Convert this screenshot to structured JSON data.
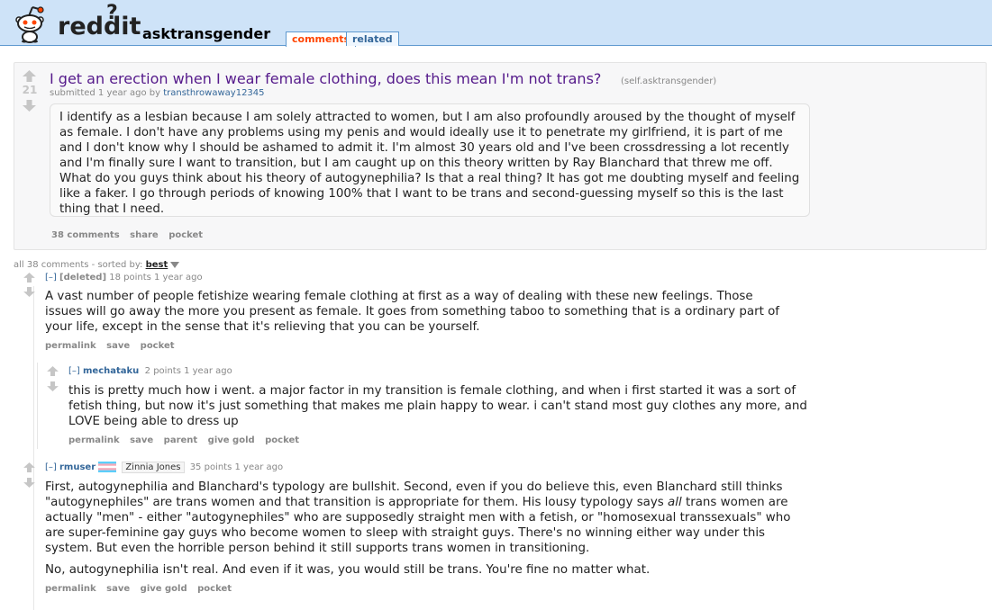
{
  "header": {
    "logo_text": "reddit",
    "logo_mark": "?",
    "subreddit": "asktransgender",
    "tabs": [
      {
        "label": "comments"
      },
      {
        "label": "related"
      }
    ]
  },
  "post": {
    "score": "21",
    "title": "I get an erection when I wear female clothing, does this mean I'm not trans?",
    "domain": "(self.asktransgender)",
    "tagline_prefix": "submitted 1 year ago by",
    "author": "transthrowaway12345",
    "selftext": "I identify as a lesbian because I am solely attracted to women, but I am also profoundly aroused by the thought of myself as female. I don't have any problems using my penis and would ideally use it to penetrate my girlfriend, it is part of me and I don't know why I should be ashamed to admit it. I'm almost 30 years old and I've been crossdressing a lot recently and I'm finally sure I want to transition, but I am caught up on this theory written by Ray Blanchard that threw me off. What do you guys think about his theory of autogynephilia? Is that a real thing? It has got me doubting myself and feeling like a faker. I go through periods of knowing 100% that I want to be trans and second-guessing myself so this is the last thing that I need.",
    "buttons": [
      "38 comments",
      "share",
      "pocket"
    ]
  },
  "sort": {
    "prefix": "all 38 comments - sorted by:",
    "value": "best"
  },
  "comments": [
    {
      "toggle": "[–]",
      "author": "[deleted]",
      "meta": "18 points 1 year ago",
      "body": [
        "A vast number of people fetishize wearing female clothing at first as a way of dealing with these new feelings. Those issues will go away the more you present as female. It goes from something taboo to something that is a ordinary part of your life, except in the sense that it's relieving that you can be yourself."
      ],
      "buttons": [
        "permalink",
        "save",
        "pocket"
      ]
    },
    {
      "toggle": "[–]",
      "author": "mechataku",
      "meta": "2 points 1 year ago",
      "body": [
        "this is pretty much how i went. a major factor in my transition is female clothing, and when i first started it was a sort of fetish thing, but now it's just something that makes me plain happy to wear. i can't stand most guy clothes any more, and LOVE being able to dress up"
      ],
      "buttons": [
        "permalink",
        "save",
        "parent",
        "give gold",
        "pocket"
      ]
    },
    {
      "toggle": "[–]",
      "author": "rmuser",
      "flair": "Zinnia Jones",
      "meta": "35 points 1 year ago",
      "body_p1_before": "First, autogynephilia and Blanchard's typology are bullshit. Second, even if you do believe this, even Blanchard still thinks \"autogynephiles\" are trans women and that transition is appropriate for them. His lousy typology says ",
      "body_p1_em": "all",
      "body_p1_after": " trans women are actually \"men\" - either \"autogynephiles\" who are supposedly straight men with a fetish, or \"homosexual transsexuals\" who are super-feminine gay guys who become women to sleep with straight guys. There's no winning either way under this system. But even the horrible person behind it still supports trans women in transitioning.",
      "body_p2": "No, autogynephilia isn't real. And even if it was, you would still be trans. You're fine no matter what.",
      "buttons": [
        "permalink",
        "save",
        "give gold",
        "pocket"
      ]
    }
  ],
  "colors": {
    "header_bg": "#cee3f8",
    "title": "#551a8b",
    "link": "#369",
    "orange": "#ff4500",
    "muted": "#888888"
  }
}
